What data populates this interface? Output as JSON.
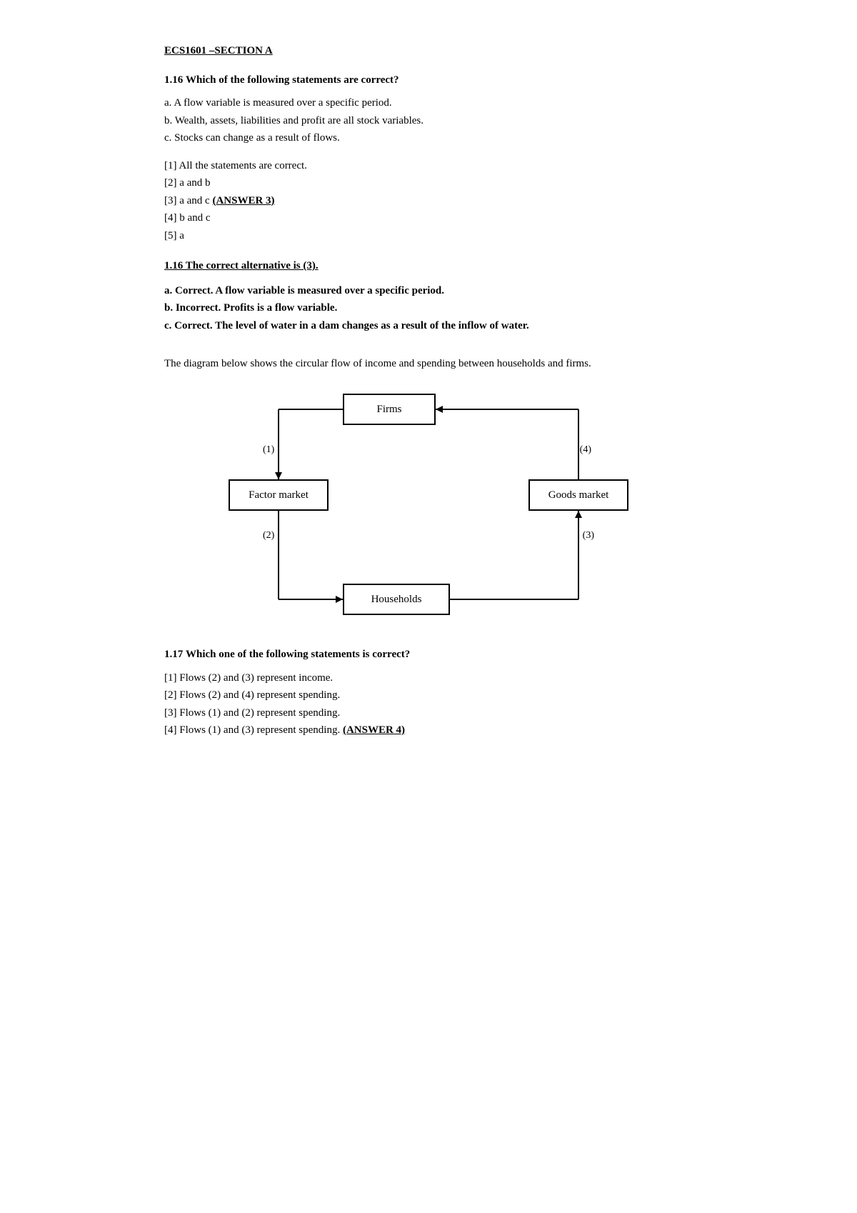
{
  "header": {
    "title": "ECS1601 –SECTION A"
  },
  "q116": {
    "question_number": "1.16",
    "question_text": "Which of the following statements are correct?",
    "statements": [
      "a. A flow variable is measured over a specific period.",
      "b. Wealth, assets, liabilities and profit are all stock variables.",
      "c. Stocks can change as a result of flows."
    ],
    "options": [
      "[1] All the statements are correct.",
      "[2] a and b",
      "[3] a and c",
      "[4] b and c",
      "[5] a"
    ],
    "answer_label": "(ANSWER 3)",
    "answer_option_index": 2
  },
  "answer116": {
    "title": "1.16 The correct alternative is (3).",
    "lines": [
      "a. Correct. A flow variable is measured over a specific period.",
      "b. Incorrect. Profits is a flow variable.",
      "c. Correct. The level of water in a dam changes as a result of the inflow of water."
    ]
  },
  "diagram_intro": "The diagram below shows the circular flow of income and spending between households and firms.",
  "diagram": {
    "firms_label": "Firms",
    "factor_market_label": "Factor market",
    "goods_market_label": "Goods market",
    "households_label": "Households",
    "flow_labels": [
      "(1)",
      "(2)",
      "(3)",
      "(4)"
    ]
  },
  "q117": {
    "question_number": "1.17",
    "question_text": "Which one of the following statements is correct?",
    "options": [
      "[1] Flows (2) and (3) represent income.",
      "[2] Flows (2) and (4) represent spending.",
      "[3] Flows (1) and (2) represent spending.",
      "[4] Flows (1) and (3) represent spending."
    ],
    "answer_label": "(ANSWER 4)",
    "answer_option_index": 3
  }
}
